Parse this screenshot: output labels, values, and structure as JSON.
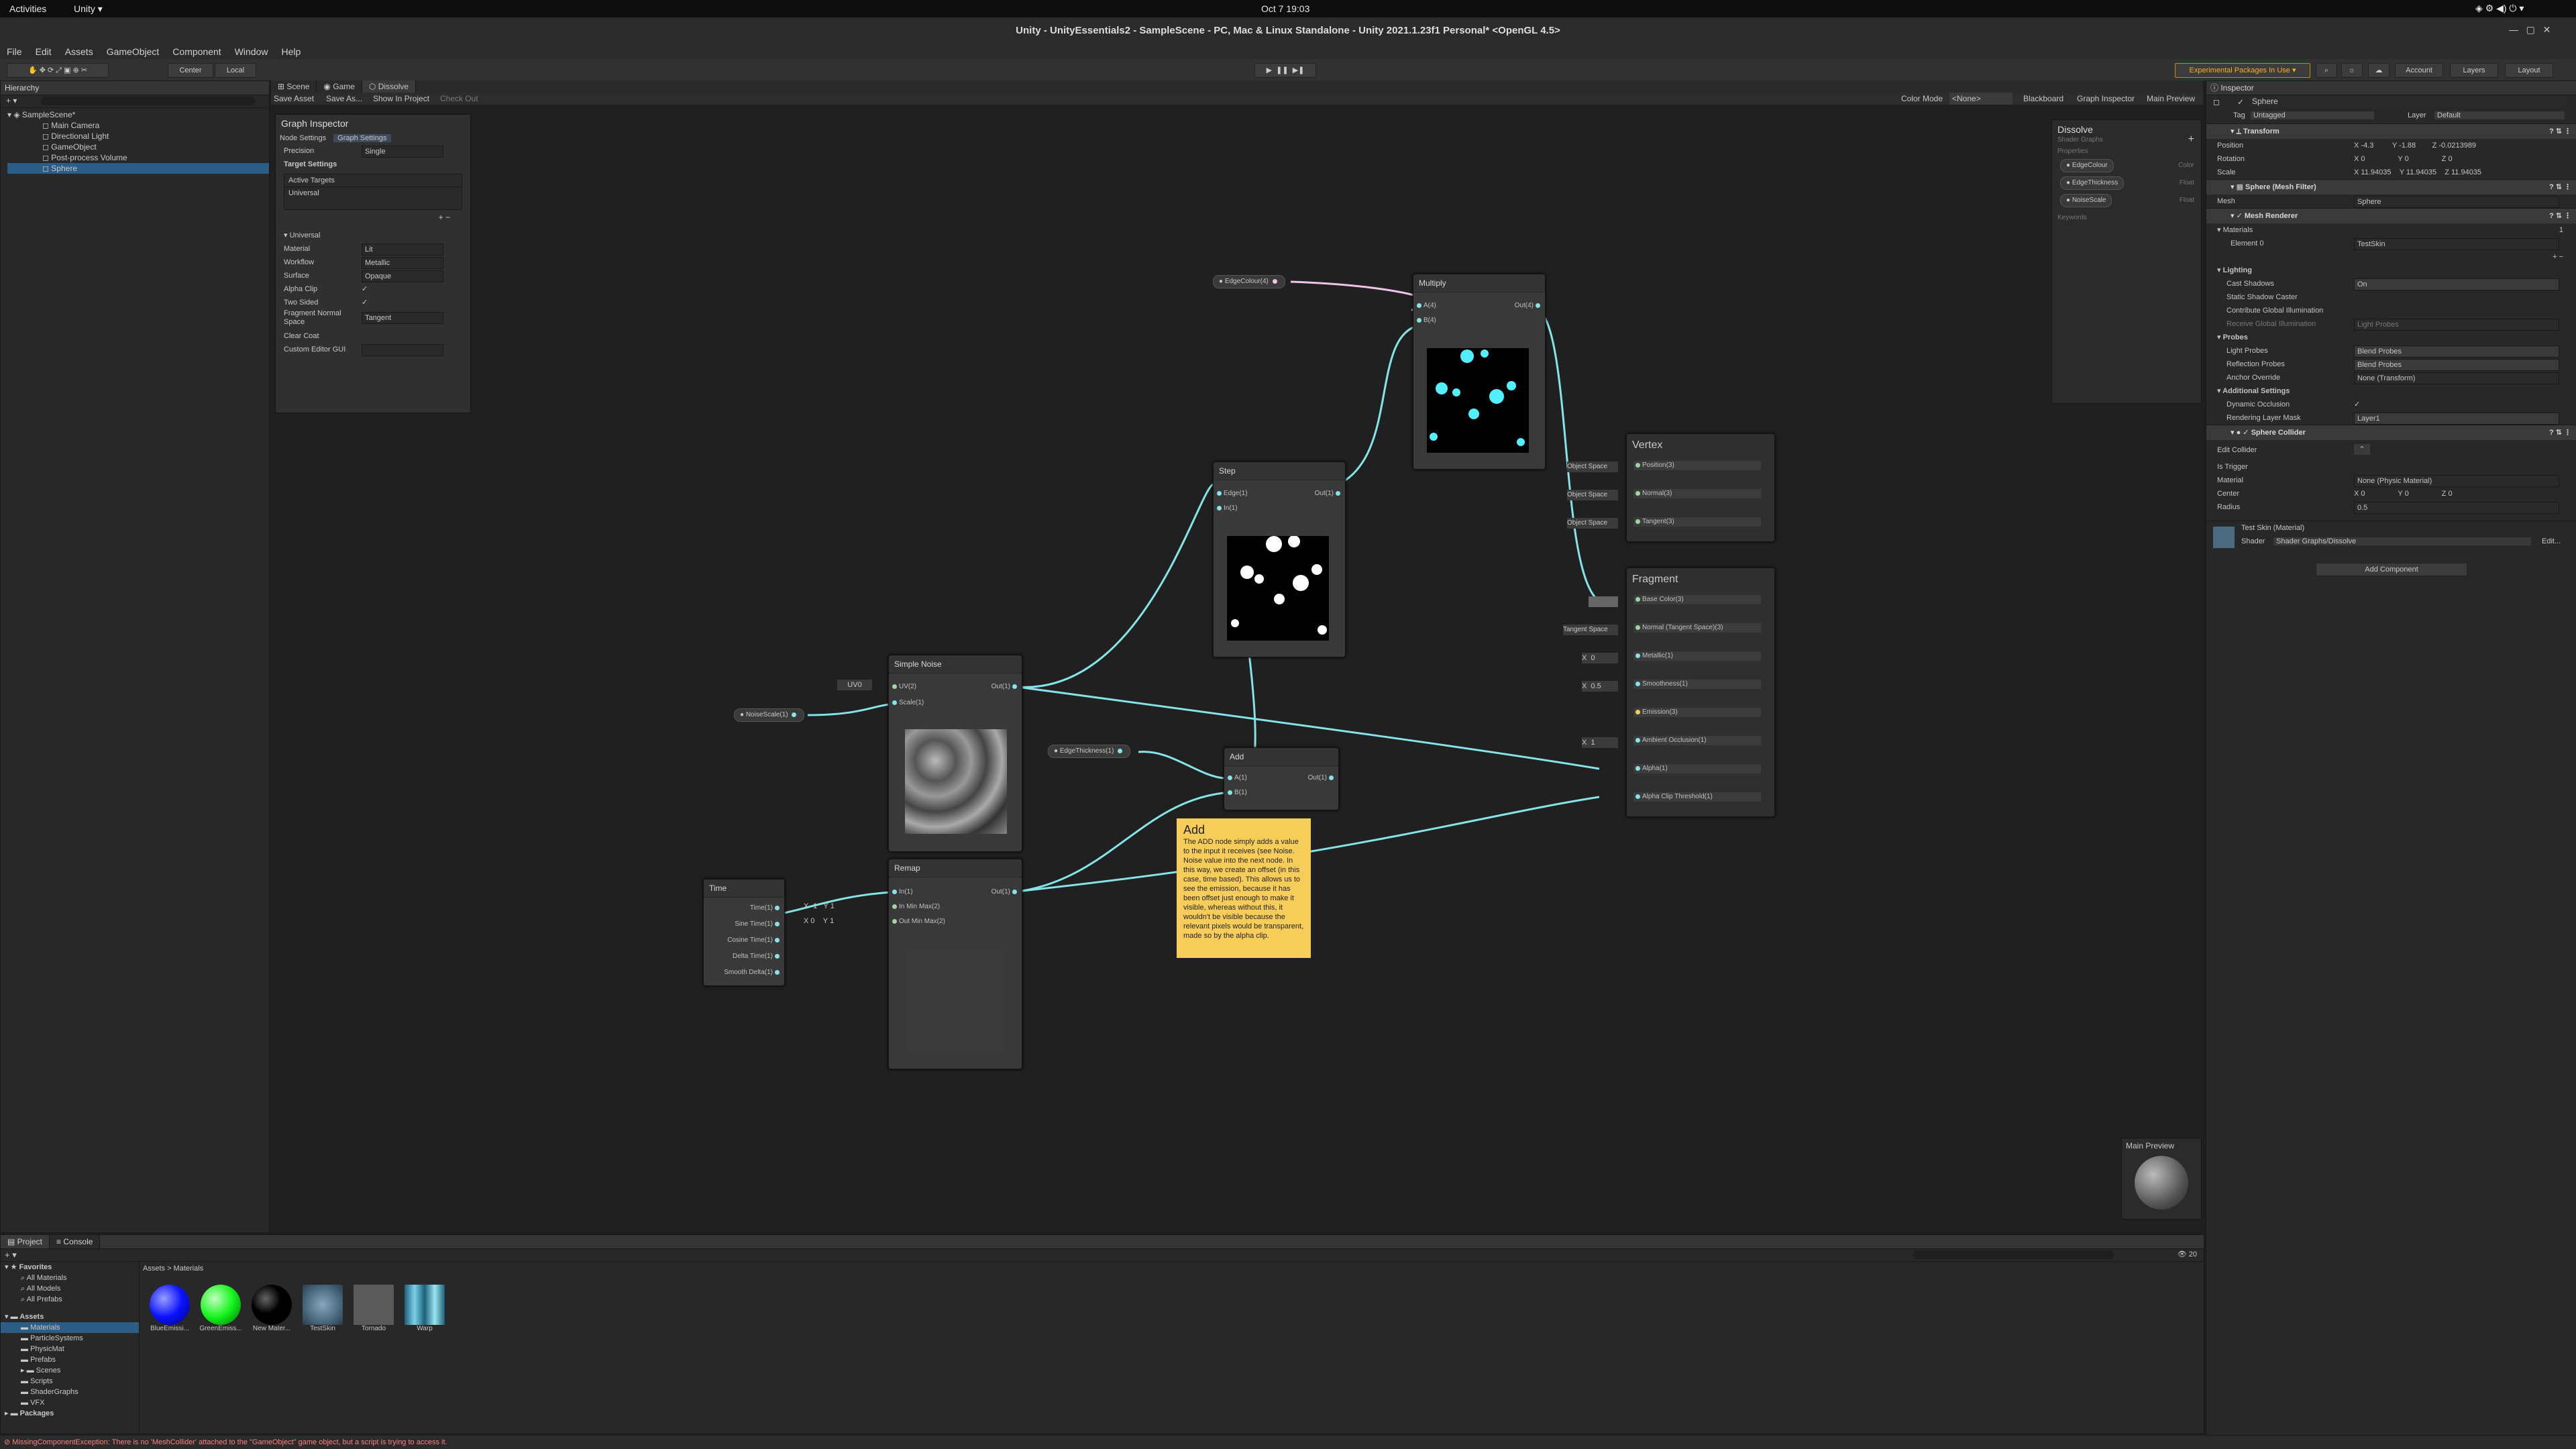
{
  "os_bar": {
    "activities": "Activities",
    "app": "Unity ▾",
    "clock": "Oct 7  19:03"
  },
  "window_title": "Unity - UnityEssentials2 - SampleScene - PC, Mac & Linux Standalone - Unity 2021.1.23f1 Personal* <OpenGL 4.5>",
  "menu": [
    "File",
    "Edit",
    "Assets",
    "GameObject",
    "Component",
    "Window",
    "Help"
  ],
  "toolbar": {
    "center": "Center",
    "local": "Local",
    "experimental": "Experimental Packages In Use ▾",
    "account": "Account",
    "layers": "Layers",
    "layout": "Layout"
  },
  "hierarchy": {
    "title": "Hierarchy",
    "scene": "SampleScene*",
    "items": [
      "Main Camera",
      "Directional Light",
      "GameObject",
      "Post-process Volume",
      "Sphere"
    ]
  },
  "center_tabs": [
    "Scene",
    "Game",
    "Dissolve"
  ],
  "graph_toolbar": {
    "save": "Save Asset",
    "save_as": "Save As...",
    "show": "Show In Project",
    "checkout": "Check Out",
    "color_mode_label": "Color Mode",
    "color_mode": "<None>",
    "blackboard": "Blackboard",
    "graph_inspector": "Graph Inspector",
    "main_preview": "Main Preview"
  },
  "graph_inspector": {
    "title": "Graph Inspector",
    "tabs": [
      "Node Settings",
      "Graph Settings"
    ],
    "precision_label": "Precision",
    "precision": "Single",
    "target_settings": "Target Settings",
    "active_targets": "Active Targets",
    "universal": "Universal",
    "universal_section": "Universal",
    "rows": [
      {
        "label": "Material",
        "value": "Lit"
      },
      {
        "label": "Workflow",
        "value": "Metallic"
      },
      {
        "label": "Surface",
        "value": "Opaque"
      },
      {
        "label": "Alpha Clip",
        "value": "✓"
      },
      {
        "label": "Two Sided",
        "value": "✓"
      },
      {
        "label": "Fragment Normal Space",
        "value": "Tangent"
      },
      {
        "label": "Clear Coat",
        "value": ""
      },
      {
        "label": "Custom Editor GUI",
        "value": ""
      }
    ]
  },
  "blackboard": {
    "title": "Dissolve",
    "subtitle": "Shader Graphs",
    "properties_label": "Properties",
    "properties": [
      {
        "name": "EdgeColour",
        "type": "Color"
      },
      {
        "name": "EdgeThickness",
        "type": "Float"
      },
      {
        "name": "NoiseScale",
        "type": "Float"
      }
    ],
    "keywords_label": "Keywords"
  },
  "nodes": {
    "multiply": {
      "title": "Multiply",
      "a": "A(4)",
      "b": "B(4)",
      "out": "Out(4)"
    },
    "step": {
      "title": "Step",
      "edge": "Edge(1)",
      "in": "In(1)",
      "out": "Out(1)"
    },
    "simple_noise": {
      "title": "Simple Noise",
      "uv": "UV(2)",
      "scale": "Scale(1)",
      "out": "Out(1)",
      "uv_field": "UV0"
    },
    "add": {
      "title": "Add",
      "a": "A(1)",
      "b": "B(1)",
      "out": "Out(1)"
    },
    "remap": {
      "title": "Remap",
      "in": "In(1)",
      "inmin": "In Min Max(2)",
      "outmin": "Out Min Max(2)",
      "out": "Out(1)"
    },
    "time": {
      "title": "Time",
      "outputs": [
        "Time(1)",
        "Sine Time(1)",
        "Cosine Time(1)",
        "Delta Time(1)",
        "Smooth Delta(1)"
      ]
    },
    "vertex": {
      "title": "Vertex",
      "ports": [
        "Position(3)",
        "Normal(3)",
        "Tangent(3)"
      ],
      "space": "Object Space"
    },
    "fragment": {
      "title": "Fragment",
      "ports": [
        "Base Color(3)",
        "Normal (Tangent Space)(3)",
        "Metallic(1)",
        "Smoothness(1)",
        "Emission(3)",
        "Ambient Occlusion(1)",
        "Alpha(1)",
        "Alpha Clip Threshold(1)"
      ],
      "tangent": "Tangent Space",
      "metallic": "0",
      "smoothness": "0.5",
      "ao": "1"
    }
  },
  "graph_pills": {
    "edge_colour": "EdgeColour(4)",
    "noise_scale": "NoiseScale(1)",
    "edge_thickness": "EdgeThickness(1)"
  },
  "remap_fields": {
    "x1": "-1",
    "y1": "1",
    "x2": "0",
    "y2": "1"
  },
  "sticky_note": {
    "title": "Add",
    "body": "The ADD node simply adds a value to the input it receives (see Noise. Noise value into the next node. In this way, we create an offset (in this case, time based). This allows us to see the emission, because it has been offset just enough to make it visible, whereas without this, it wouldn't be visible because the relevant pixels would be transparent, made so by the alpha clip."
  },
  "main_preview": "Main Preview",
  "inspector": {
    "title": "Inspector",
    "object": "Sphere",
    "tag_label": "Tag",
    "tag": "Untagged",
    "layer_label": "Layer",
    "layer": "Default",
    "transform": "Transform",
    "position": {
      "label": "Position",
      "x": "-4.3",
      "y": "-1.88",
      "z": "-0.0213989"
    },
    "rotation": {
      "label": "Rotation",
      "x": "0",
      "y": "0",
      "z": "0"
    },
    "scale": {
      "label": "Scale",
      "x": "11.94035",
      "y": "11.94035",
      "z": "11.94035"
    },
    "mesh_filter": "Sphere (Mesh Filter)",
    "mesh_label": "Mesh",
    "mesh": "Sphere",
    "mesh_renderer": "Mesh Renderer",
    "materials_label": "Materials",
    "materials_count": "1",
    "element0_label": "Element 0",
    "element0": "TestSkin",
    "lighting": "Lighting",
    "cast_shadows_label": "Cast Shadows",
    "cast_shadows": "On",
    "static_shadow": "Static Shadow Caster",
    "contribute_gi": "Contribute Global Illumination",
    "receive_gi_label": "Receive Global Illumination",
    "receive_gi": "Light Probes",
    "probes": "Probes",
    "light_probes_label": "Light Probes",
    "light_probes": "Blend Probes",
    "reflection_label": "Reflection Probes",
    "reflection": "Blend Probes",
    "anchor_label": "Anchor Override",
    "anchor": "None (Transform)",
    "additional": "Additional Settings",
    "dyn_occ": "Dynamic Occlusion",
    "render_layer_label": "Rendering Layer Mask",
    "render_layer": "Layer1",
    "collider": "Sphere Collider",
    "edit_collider": "Edit Collider",
    "is_trigger": "Is Trigger",
    "material_label": "Material",
    "material": "None (Physic Material)",
    "center": {
      "label": "Center",
      "x": "0",
      "y": "0",
      "z": "0"
    },
    "radius_label": "Radius",
    "radius": "0.5",
    "mat_name": "Test Skin (Material)",
    "shader_label": "Shader",
    "shader": "Shader Graphs/Dissolve",
    "edit": "Edit...",
    "add_component": "Add Component"
  },
  "project": {
    "tabs": [
      "Project",
      "Console"
    ],
    "favorites": "Favorites",
    "fav_items": [
      "All Materials",
      "All Models",
      "All Prefabs"
    ],
    "assets": "Assets",
    "folders": [
      "Materials",
      "ParticleSystems",
      "PhysicMat",
      "Prefabs",
      "Scenes",
      "Scripts",
      "ShaderGraphs",
      "VFX"
    ],
    "packages": "Packages",
    "breadcrumb": "Assets  >  Materials",
    "files": [
      {
        "name": "BlueEmissi...",
        "color": "#0a12ff"
      },
      {
        "name": "GreenEmiss...",
        "color": "#14f51a"
      },
      {
        "name": "New Mater...",
        "color": "#000000"
      },
      {
        "name": "TestSkin",
        "color": "#4a6a80"
      },
      {
        "name": "Tornado",
        "color": "#6a6a6a"
      },
      {
        "name": "Warp",
        "color": "#2e7e9a"
      }
    ],
    "count": "20"
  },
  "status": "MissingComponentException: There is no 'MeshCollider' attached to the \"GameObject\" game object, but a script is trying to access it."
}
